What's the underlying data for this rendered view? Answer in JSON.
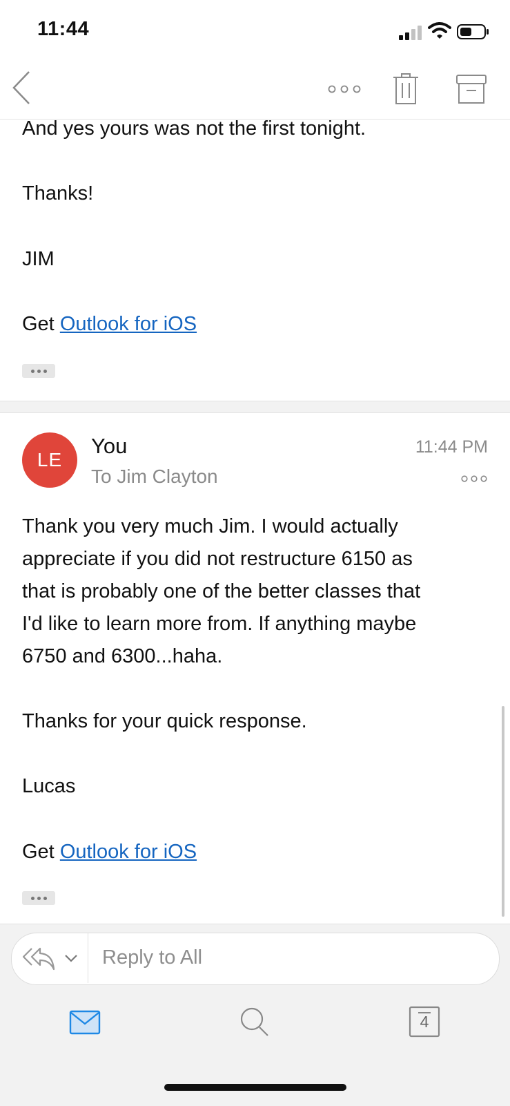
{
  "status_bar": {
    "time": "11:44"
  },
  "toolbar": {
    "back_icon": "chevron-left-icon",
    "more_icon": "more-horizontal-icon",
    "trash_icon": "trash-icon",
    "archive_icon": "archive-icon"
  },
  "previous_message": {
    "line1": "And yes yours was not the first tonight.",
    "thanks": "Thanks!",
    "signature": "JIM",
    "get_prefix": "Get ",
    "outlook_link": "Outlook for iOS"
  },
  "message": {
    "avatar_initials": "LE",
    "avatar_color": "#e0453a",
    "sender": "You",
    "recipient": "To Jim Clayton",
    "time": "11:44 PM",
    "body_lines": [
      "Thank you very much Jim. I would actually",
      "appreciate if you did not restructure 6150 as",
      "that is probably one of the better classes that",
      "I'd like to learn more from. If anything maybe",
      "6750 and 6300...haha."
    ],
    "thanks_line": "Thanks for your quick response.",
    "signature": "Lucas",
    "get_prefix": "Get ",
    "outlook_link": "Outlook for iOS"
  },
  "reply_bar": {
    "placeholder": "Reply to All"
  },
  "tab_bar": {
    "calendar_day": "4"
  },
  "colors": {
    "link": "#1565c0",
    "accent": "#1e88e5"
  }
}
